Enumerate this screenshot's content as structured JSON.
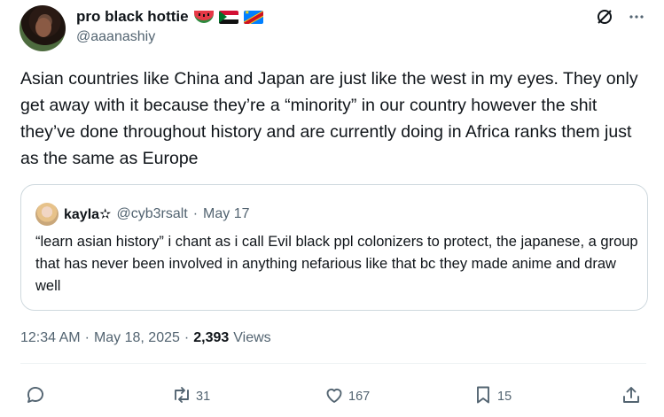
{
  "author": {
    "display_name": "pro black hottie",
    "handle": "@aaanashiy",
    "flag_icons": [
      "watermelon-icon",
      "sudan-flag-icon",
      "drc-flag-icon"
    ]
  },
  "tweet": {
    "text": "Asian countries like China and Japan are just like the west in my eyes. They only get away with it because they’re a “minority” in our country however the shit they’ve done throughout history and are currently doing in Africa ranks them just as the same as Europe"
  },
  "quote": {
    "name": "kayla✫",
    "handle": "@cyb3rsalt",
    "separator": "·",
    "date": "May 17",
    "text": "“learn asian history” i chant as i call Evil black ppl colonizers to protect, the japanese, a group that has never been involved in anything nefarious like that bc they made anime and draw well"
  },
  "meta": {
    "time": "12:34 AM",
    "sep1": "·",
    "date": "May 18, 2025",
    "sep2": "·",
    "views_count": "2,393",
    "views_label": "Views"
  },
  "actions": {
    "reply_count": "",
    "retweet_count": "31",
    "like_count": "167",
    "bookmark_count": "15"
  },
  "colors": {
    "text": "#0f1419",
    "secondary": "#536471",
    "border": "#cfd9de"
  }
}
